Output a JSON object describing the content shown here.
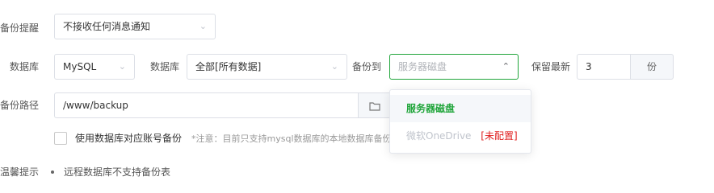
{
  "form": {
    "backup_notify": {
      "label": "备份提醒",
      "value": "不接收任何消息通知"
    },
    "db_type": {
      "label": "数据库",
      "value": "MySQL"
    },
    "database": {
      "label": "数据库",
      "value": "全部[所有数据]"
    },
    "backup_to": {
      "label": "备份到",
      "placeholder": "服务器磁盘"
    },
    "retain": {
      "label": "保留最新",
      "value": "3",
      "unit": "份"
    },
    "backup_path": {
      "label": "备份路径",
      "value": "/www/backup"
    },
    "use_account_checkbox": {
      "label": "使用数据库对应账号备份",
      "note": "*注意：目前只支持mysql数据库的本地数据库备份",
      "checked": false
    },
    "tip": {
      "label": "温馨提示",
      "items": [
        "远程数据库不支持备份表"
      ]
    }
  },
  "backup_to_dropdown": {
    "options": [
      {
        "label": "服务器磁盘",
        "selected": true
      },
      {
        "label": "微软OneDrive",
        "tag": "[未配置]",
        "disabled": true
      }
    ]
  },
  "colors": {
    "accent": "#20a53a",
    "danger": "#e02020",
    "border": "#dcdfe6",
    "selected_bg": "#f5f7fa"
  },
  "icons": {
    "folder": "folder-icon",
    "chevron": "chevron-down-icon"
  }
}
